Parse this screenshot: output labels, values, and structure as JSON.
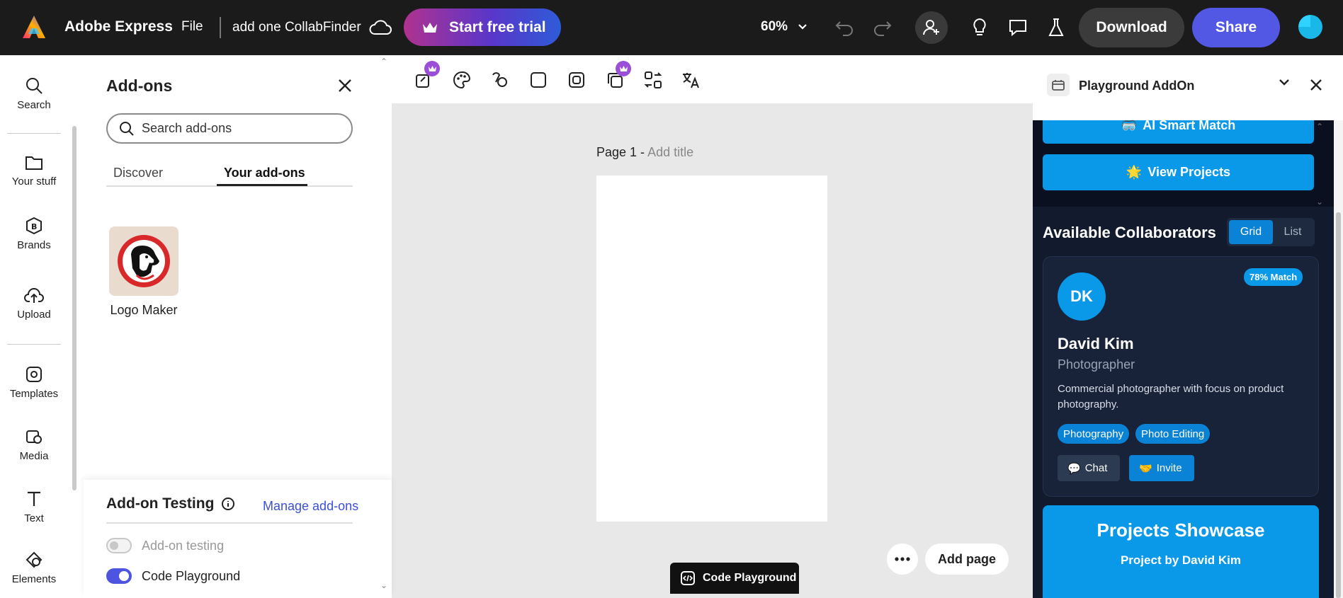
{
  "topbar": {
    "app_name": "Adobe Express",
    "file_label": "File",
    "document_name": "add one CollabFinder",
    "trial_label": "Start free trial",
    "zoom_level": "60%",
    "download_label": "Download",
    "share_label": "Share"
  },
  "rail": {
    "items": [
      {
        "label": "Search",
        "icon": "search-icon"
      },
      {
        "label": "Your stuff",
        "icon": "folder-icon"
      },
      {
        "label": "Brands",
        "icon": "brand-icon"
      },
      {
        "label": "Upload",
        "icon": "upload-icon"
      },
      {
        "label": "Templates",
        "icon": "templates-icon"
      },
      {
        "label": "Media",
        "icon": "media-icon"
      },
      {
        "label": "Text",
        "icon": "text-icon"
      },
      {
        "label": "Elements",
        "icon": "elements-icon"
      }
    ]
  },
  "addons": {
    "title": "Add-ons",
    "search_placeholder": "Search add-ons",
    "tabs": [
      "Discover",
      "Your add-ons"
    ],
    "active_tab": "Your add-ons",
    "installed": [
      {
        "name": "Logo Maker"
      }
    ],
    "testing_title": "Add-on Testing",
    "manage_label": "Manage add-ons",
    "toggles": [
      {
        "label": "Add-on testing",
        "on": false
      },
      {
        "label": "Code Playground",
        "on": true
      }
    ]
  },
  "canvas": {
    "page_label": "Page 1 -",
    "page_title_placeholder": "Add title",
    "add_page_label": "Add page",
    "code_playground_label": "Code Playground"
  },
  "right_panel": {
    "title": "Playground AddOn",
    "ai_match_label": "AI Smart Match",
    "ai_match_emoji": "🥽",
    "view_projects_label": "View Projects",
    "view_projects_emoji": "🌟",
    "collaborators_title": "Available Collaborators",
    "view_modes": [
      "Grid",
      "List"
    ],
    "active_view": "Grid",
    "card": {
      "initials": "DK",
      "match": "78% Match",
      "name": "David Kim",
      "role": "Photographer",
      "description": "Commercial photographer with focus on product photography.",
      "skills": [
        "Photography",
        "Photo Editing"
      ],
      "chat_label": "Chat",
      "chat_emoji": "💬",
      "invite_label": "Invite",
      "invite_emoji": "🤝"
    },
    "showcase_title": "Projects Showcase",
    "showcase_subtitle": "Project by David Kim"
  },
  "colors": {
    "topbar_bg": "#1b1b1b",
    "share_accent": "#5258e4",
    "panel_dark": "#121b2e",
    "addon_blue": "#0a98e8"
  }
}
